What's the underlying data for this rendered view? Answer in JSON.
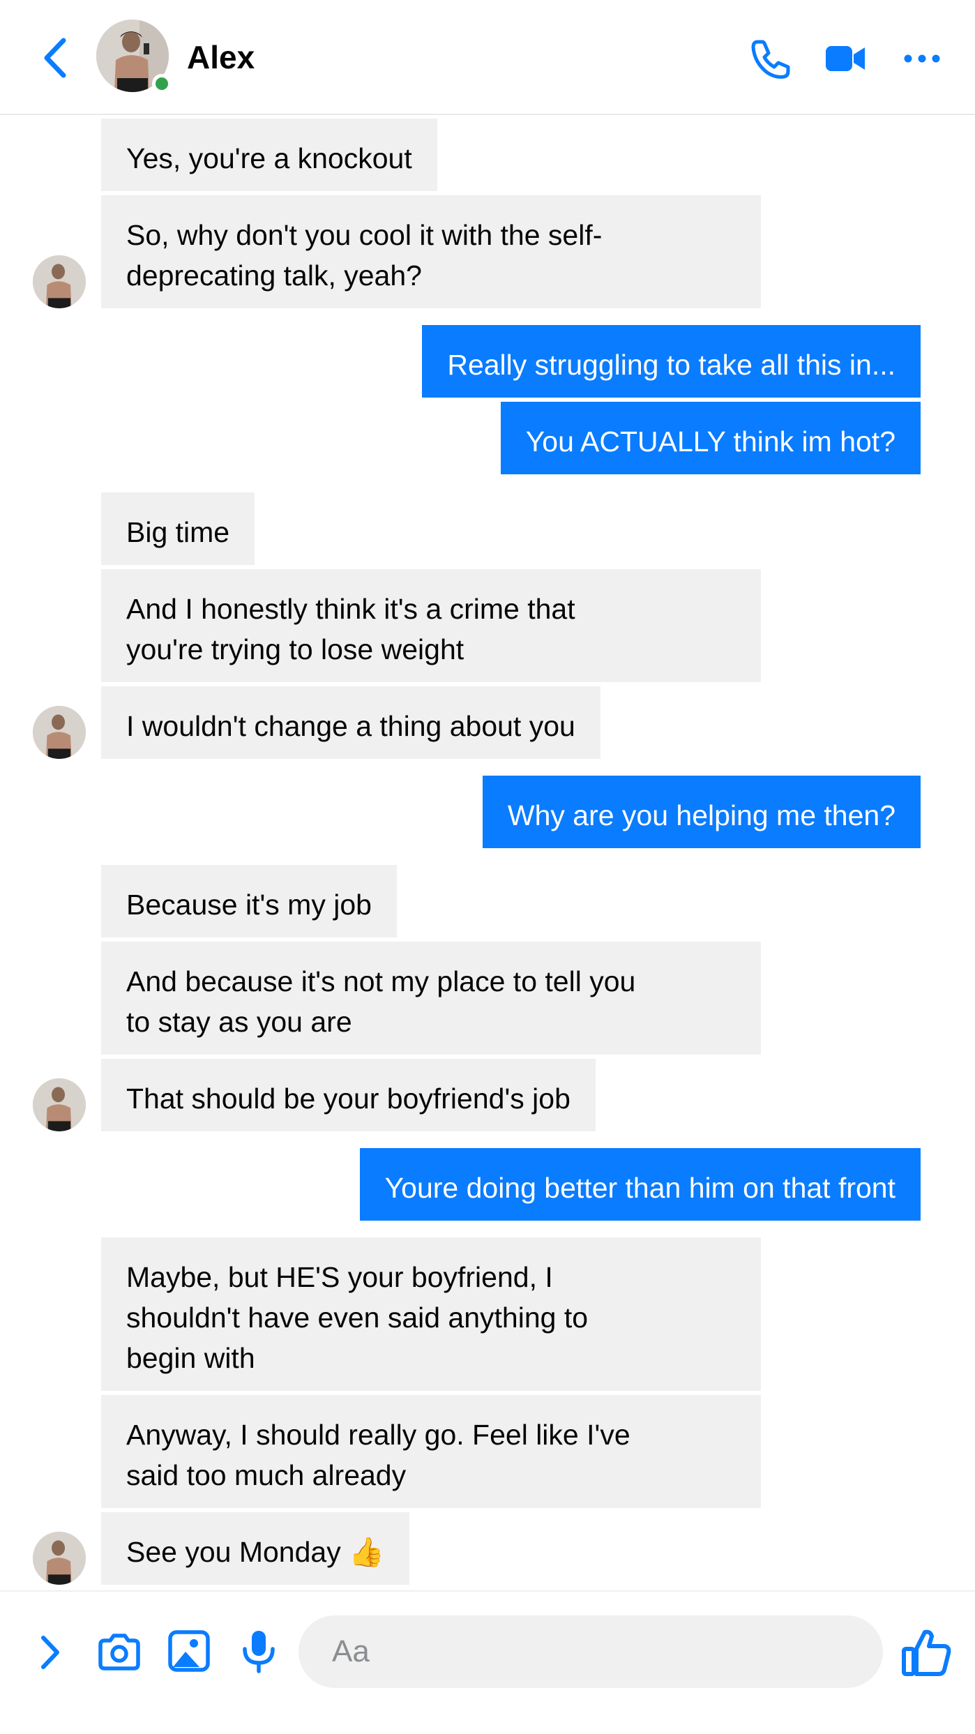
{
  "header": {
    "contact_name": "Alex",
    "status": "online",
    "icons": [
      "back-arrow-icon",
      "phone-icon",
      "video-camera-icon",
      "more-options-icon"
    ]
  },
  "messages": [
    {
      "from": "contact",
      "text": "Yes, you're a knockout"
    },
    {
      "from": "contact",
      "text": "So, why don't you cool it with the self-\ndeprecating talk, yeah?"
    },
    {
      "from": "me",
      "text": "Really struggling to take all this in..."
    },
    {
      "from": "me",
      "text": "You ACTUALLY think im hot?"
    },
    {
      "from": "contact",
      "text": "Big time"
    },
    {
      "from": "contact",
      "text": "And I honestly think it's a crime that\nyou're trying to lose weight"
    },
    {
      "from": "contact",
      "text": "I wouldn't change a thing about you"
    },
    {
      "from": "me",
      "text": "Why are you helping me then?"
    },
    {
      "from": "contact",
      "text": "Because it's my job"
    },
    {
      "from": "contact",
      "text": "And because it's not my place to tell you\nto stay as you are"
    },
    {
      "from": "contact",
      "text": "That should be your boyfriend's job"
    },
    {
      "from": "me",
      "text": "Youre doing better than him on that front"
    },
    {
      "from": "contact",
      "text": "Maybe, but HE'S your boyfriend, I\nshouldn't have even said anything to\nbegin with"
    },
    {
      "from": "contact",
      "text": "Anyway, I should really go. Feel like I've\nsaid too much already"
    },
    {
      "from": "contact",
      "text": "See you Monday 👍"
    }
  ],
  "composer": {
    "placeholder": "Aa",
    "icons": [
      "expand-chevron-icon",
      "camera-icon",
      "gallery-icon",
      "microphone-icon",
      "thumbs-up-icon"
    ]
  },
  "colors": {
    "accent": "#0a7cff",
    "incoming_bubble": "#f0f0f0",
    "online_dot": "#31a24c"
  }
}
